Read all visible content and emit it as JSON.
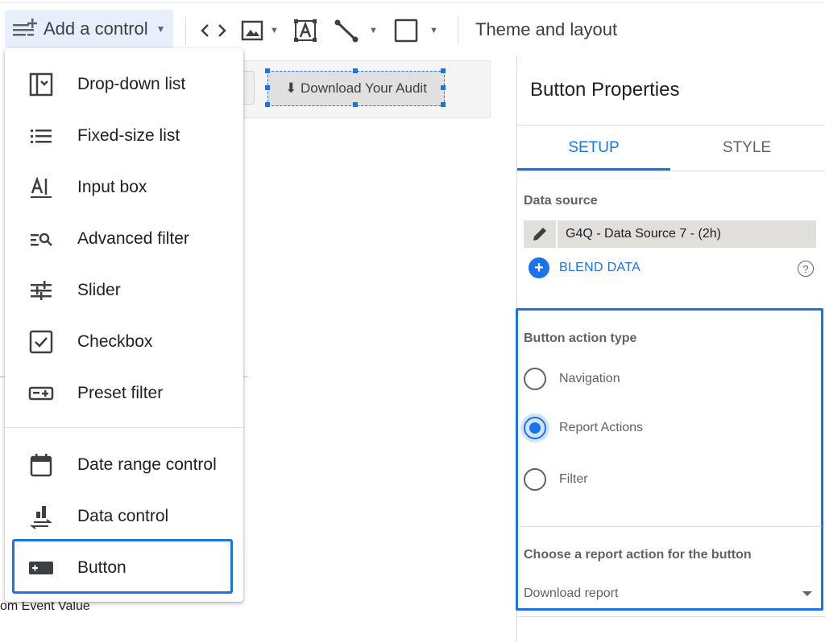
{
  "toolbar": {
    "add_control_label": "Add a control",
    "theme_label": "Theme and layout"
  },
  "canvas": {
    "download_button_label": "⬇ Download Your Audit",
    "event_value_text": "om Event Value"
  },
  "menu": {
    "items": [
      {
        "label": "Drop-down list",
        "icon": "dropdown-list-icon"
      },
      {
        "label": "Fixed-size list",
        "icon": "list-icon"
      },
      {
        "label": "Input box",
        "icon": "input-box-icon"
      },
      {
        "label": "Advanced filter",
        "icon": "advanced-filter-icon"
      },
      {
        "label": "Slider",
        "icon": "slider-icon"
      },
      {
        "label": "Checkbox",
        "icon": "checkbox-icon"
      },
      {
        "label": "Preset filter",
        "icon": "preset-filter-icon"
      },
      {
        "label": "Date range control",
        "icon": "calendar-icon"
      },
      {
        "label": "Data control",
        "icon": "data-control-icon"
      },
      {
        "label": "Button",
        "icon": "button-icon"
      }
    ],
    "selected": "Button"
  },
  "panel": {
    "title": "Button Properties",
    "tabs": [
      "SETUP",
      "STYLE"
    ],
    "active_tab": "SETUP",
    "data_source_label": "Data source",
    "data_source_name": "G4Q - Data Source 7 - (2h)",
    "blend_label": "BLEND DATA",
    "help_symbol": "?",
    "action_type_label": "Button action type",
    "action_options": [
      "Navigation",
      "Report Actions",
      "Filter"
    ],
    "selected_action": "Report Actions",
    "report_action_label": "Choose a report action for the button",
    "report_action_value": "Download report"
  },
  "colors": {
    "accent": "#1a73e8",
    "toolbar_active_bg": "#e8eefb",
    "data_source_bg": "#e0dfdb"
  }
}
